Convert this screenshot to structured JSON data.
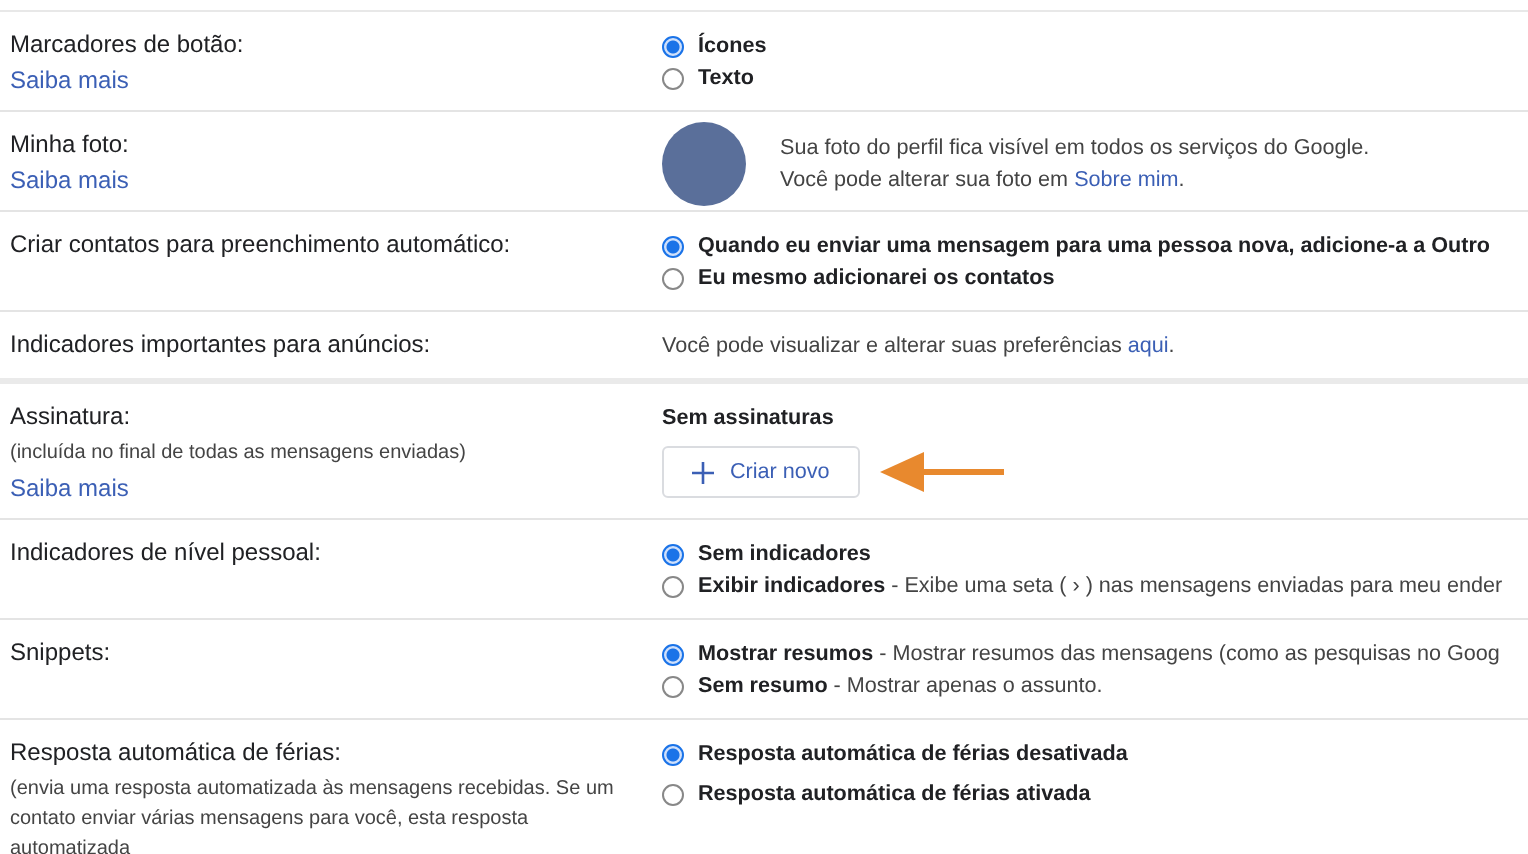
{
  "settings": [
    {
      "kind": "radio",
      "label": "Marcadores de botão:",
      "link": "Saiba mais",
      "options": [
        {
          "label": "Ícones",
          "selected": true
        },
        {
          "label": "Texto",
          "selected": false
        }
      ]
    },
    {
      "kind": "photo",
      "label": "Minha foto:",
      "link": "Saiba mais",
      "lines": [
        {
          "text": "Sua foto do perfil fica visível em todos os serviços do Google."
        },
        {
          "text": "Você pode alterar sua foto em ",
          "link": "Sobre mim",
          "after": "."
        }
      ]
    },
    {
      "kind": "radio",
      "label": "Criar contatos para preenchimento automático:",
      "options": [
        {
          "label": "Quando eu enviar uma mensagem para uma pessoa nova, adicione-a a Outro",
          "selected": true
        },
        {
          "label": "Eu mesmo adicionarei os contatos",
          "selected": false
        }
      ]
    },
    {
      "kind": "text",
      "label": "Indicadores importantes para anúncios:",
      "lines": [
        {
          "text": "Você pode visualizar e alterar suas preferências ",
          "link": "aqui",
          "after": "."
        }
      ]
    },
    {
      "kind": "signature",
      "label": "Assinatura:",
      "note": "(incluída no final de todas as mensagens enviadas)",
      "link": "Saiba mais",
      "status": "Sem assinaturas",
      "button": "Criar novo"
    },
    {
      "kind": "radio",
      "label": "Indicadores de nível pessoal:",
      "options": [
        {
          "label": "Sem indicadores",
          "selected": true
        },
        {
          "label": "Exibir indicadores",
          "description": " - Exibe uma seta ( › ) nas mensagens enviadas para meu ender",
          "selected": false
        }
      ]
    },
    {
      "kind": "radio",
      "label": "Snippets:",
      "options": [
        {
          "label": "Mostrar resumos",
          "description": " - Mostrar resumos das mensagens (como as pesquisas no Goog",
          "selected": true
        },
        {
          "label": "Sem resumo",
          "description": " - Mostrar apenas o assunto.",
          "selected": false
        }
      ]
    },
    {
      "kind": "radio",
      "label": "Resposta automática de férias:",
      "note": "(envia uma resposta automatizada às mensagens recebidas. Se um contato enviar várias mensagens para você, esta resposta automatizada",
      "spaced": true,
      "options": [
        {
          "label": "Resposta automática de férias desativada",
          "selected": true
        },
        {
          "label": "Resposta automática de férias ativada",
          "selected": false
        }
      ]
    }
  ]
}
